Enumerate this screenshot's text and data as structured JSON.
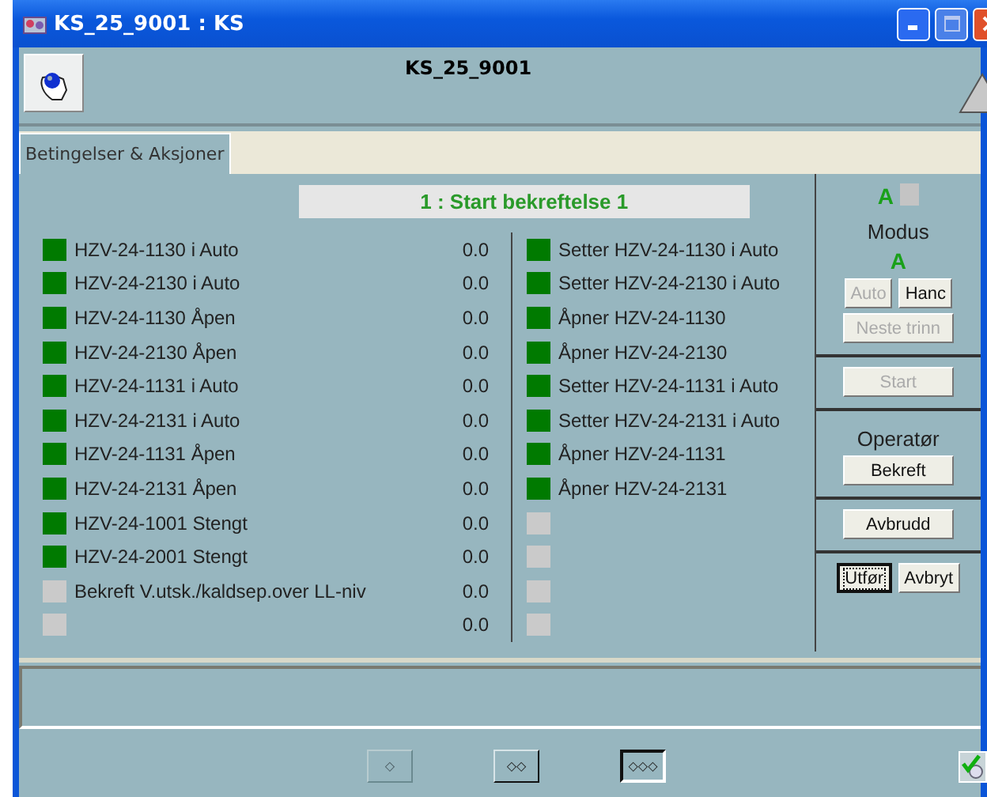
{
  "window": {
    "title": "KS_25_9001 : KS"
  },
  "header": {
    "title": "KS_25_9001"
  },
  "tabs": [
    {
      "label": "Betingelser & Aksjoner",
      "selected": true
    }
  ],
  "step": {
    "title": "1 : Start bekreftelse 1"
  },
  "conditions": [
    {
      "label": "HZV-24-1130 i Auto",
      "value": "0.0",
      "active": true
    },
    {
      "label": "HZV-24-2130 i Auto",
      "value": "0.0",
      "active": true
    },
    {
      "label": "HZV-24-1130 Åpen",
      "value": "0.0",
      "active": true
    },
    {
      "label": "HZV-24-2130 Åpen",
      "value": "0.0",
      "active": true
    },
    {
      "label": "HZV-24-1131 i Auto",
      "value": "0.0",
      "active": true
    },
    {
      "label": "HZV-24-2131 i Auto",
      "value": "0.0",
      "active": true
    },
    {
      "label": "HZV-24-1131 Åpen",
      "value": "0.0",
      "active": true
    },
    {
      "label": "HZV-24-2131 Åpen",
      "value": "0.0",
      "active": true
    },
    {
      "label": "HZV-24-1001 Stengt",
      "value": "0.0",
      "active": true
    },
    {
      "label": "HZV-24-2001 Stengt",
      "value": "0.0",
      "active": true
    },
    {
      "label": "Bekreft V.utsk./kaldsep.over LL-niv",
      "value": "0.0",
      "active": false
    },
    {
      "value": "0.0",
      "active": false
    }
  ],
  "actions": [
    {
      "label": "Setter HZV-24-1130 i Auto",
      "active": true
    },
    {
      "label": "Setter HZV-24-2130 i Auto",
      "active": true
    },
    {
      "label": "Åpner HZV-24-1130",
      "active": true
    },
    {
      "label": "Åpner HZV-24-2130",
      "active": true
    },
    {
      "label": "Setter HZV-24-1131 i Auto",
      "active": true
    },
    {
      "label": "Setter HZV-24-2131 i Auto",
      "active": true
    },
    {
      "label": "Åpner HZV-24-1131",
      "active": true
    },
    {
      "label": "Åpner HZV-24-2131",
      "active": true
    },
    {
      "active": false
    },
    {
      "active": false
    },
    {
      "active": false
    },
    {
      "active": false
    }
  ],
  "side": {
    "sections": [
      {
        "rows": [
          [
            {
              "kind": "letter",
              "text": "A"
            },
            {
              "kind": "lamp",
              "active": false
            }
          ],
          [
            {
              "kind": "label",
              "text": "Modus"
            }
          ],
          [
            {
              "kind": "letter",
              "text": "A"
            }
          ],
          [
            {
              "kind": "button",
              "text": "Auto",
              "disabled": true,
              "focused": false
            },
            {
              "kind": "button",
              "text": "Hanc",
              "disabled": false,
              "focused": false
            }
          ],
          [
            {
              "kind": "button",
              "text": "Neste trinn",
              "disabled": true,
              "focused": false
            }
          ]
        ]
      },
      {
        "rows": [
          [
            {
              "kind": "button",
              "text": "Start",
              "disabled": true,
              "focused": false
            }
          ]
        ]
      },
      {
        "rows": [
          [
            {
              "kind": "label",
              "text": "Operatør"
            }
          ],
          [
            {
              "kind": "button",
              "text": "Bekreft",
              "disabled": false,
              "focused": false
            }
          ]
        ]
      },
      {
        "rows": [
          [
            {
              "kind": "button",
              "text": "Avbrudd",
              "disabled": false,
              "focused": false
            }
          ]
        ]
      },
      {
        "rows": [
          [
            {
              "kind": "button",
              "text": "Utfør",
              "disabled": false,
              "focused": true
            },
            {
              "kind": "button",
              "text": "Avbryt",
              "disabled": false,
              "focused": false
            }
          ]
        ]
      }
    ]
  },
  "nav_buttons": [
    {
      "symbol": "◇",
      "disabled": true,
      "selected": false
    },
    {
      "symbol": "◇◇",
      "disabled": false,
      "selected": false
    },
    {
      "symbol": "◇◇◇",
      "disabled": false,
      "selected": true
    }
  ]
}
